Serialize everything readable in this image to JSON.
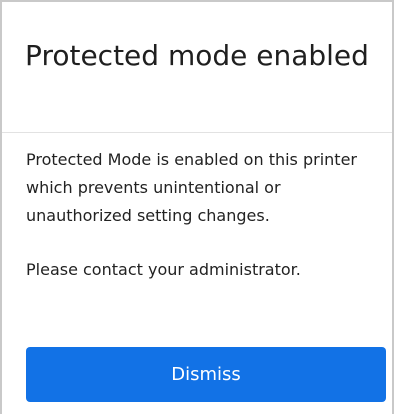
{
  "dialog": {
    "title": "Protected mode enabled",
    "message": "Protected Mode is enabled on this printer which prevents unintentional or unauthorized setting changes.",
    "contact": "Please contact your administrator.",
    "dismiss_label": "Dismiss"
  },
  "colors": {
    "accent": "#1272e6",
    "border": "#c9c9c9",
    "text": "#1f1f1f"
  }
}
